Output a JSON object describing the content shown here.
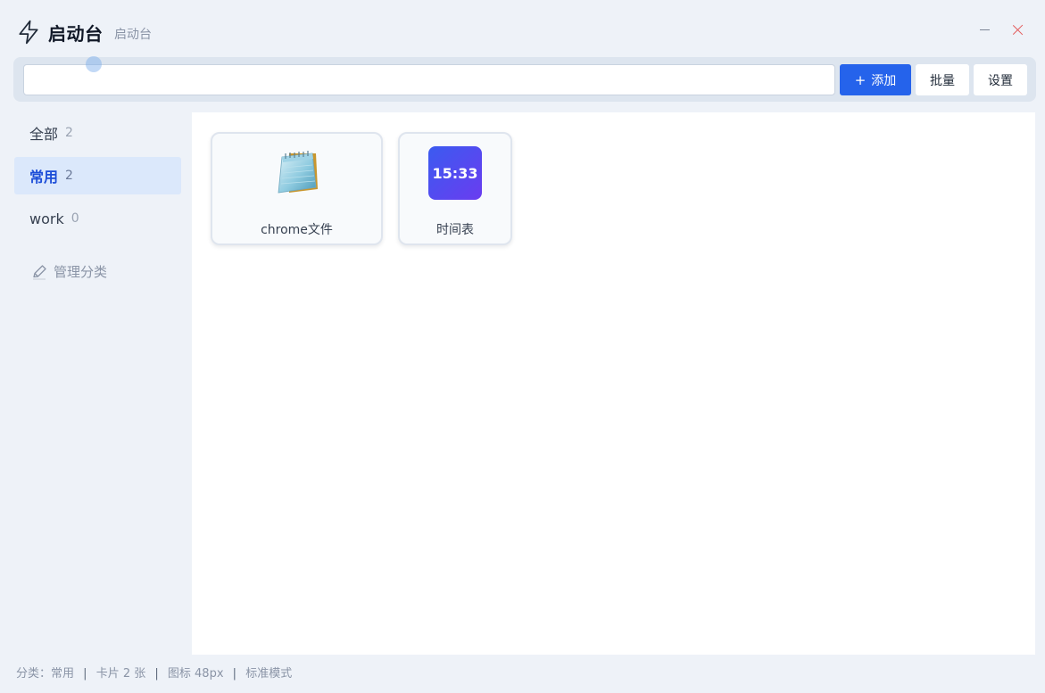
{
  "title": {
    "app_title": "启动台",
    "subtitle": "启动台"
  },
  "toolbar": {
    "search_value": "",
    "add_label": "添加",
    "add_prefix": "+",
    "batch_label": "批量",
    "settings_label": "设置"
  },
  "sidebar": {
    "items": [
      {
        "label": "全部",
        "count": "2",
        "active": false
      },
      {
        "label": "常用",
        "count": "2",
        "active": true
      },
      {
        "label": "work",
        "count": "0",
        "active": false
      }
    ],
    "manage_label": "管理分类"
  },
  "cards": [
    {
      "label": "chrome文件",
      "icon": "notepad-icon"
    },
    {
      "label": "时间表",
      "icon": "clock-icon",
      "icon_text": "15:33"
    }
  ],
  "status": {
    "category": "分类：常用",
    "cards": "卡片 2 张",
    "icon_size": "图标 48px",
    "mode": "标准模式",
    "separator": "|"
  },
  "colors": {
    "accent": "#2563eb",
    "active_bg": "#dbe8fb",
    "close": "#e35d5d",
    "clock_gradient_start": "#3b5bf0",
    "clock_gradient_end": "#6a3cf0"
  }
}
